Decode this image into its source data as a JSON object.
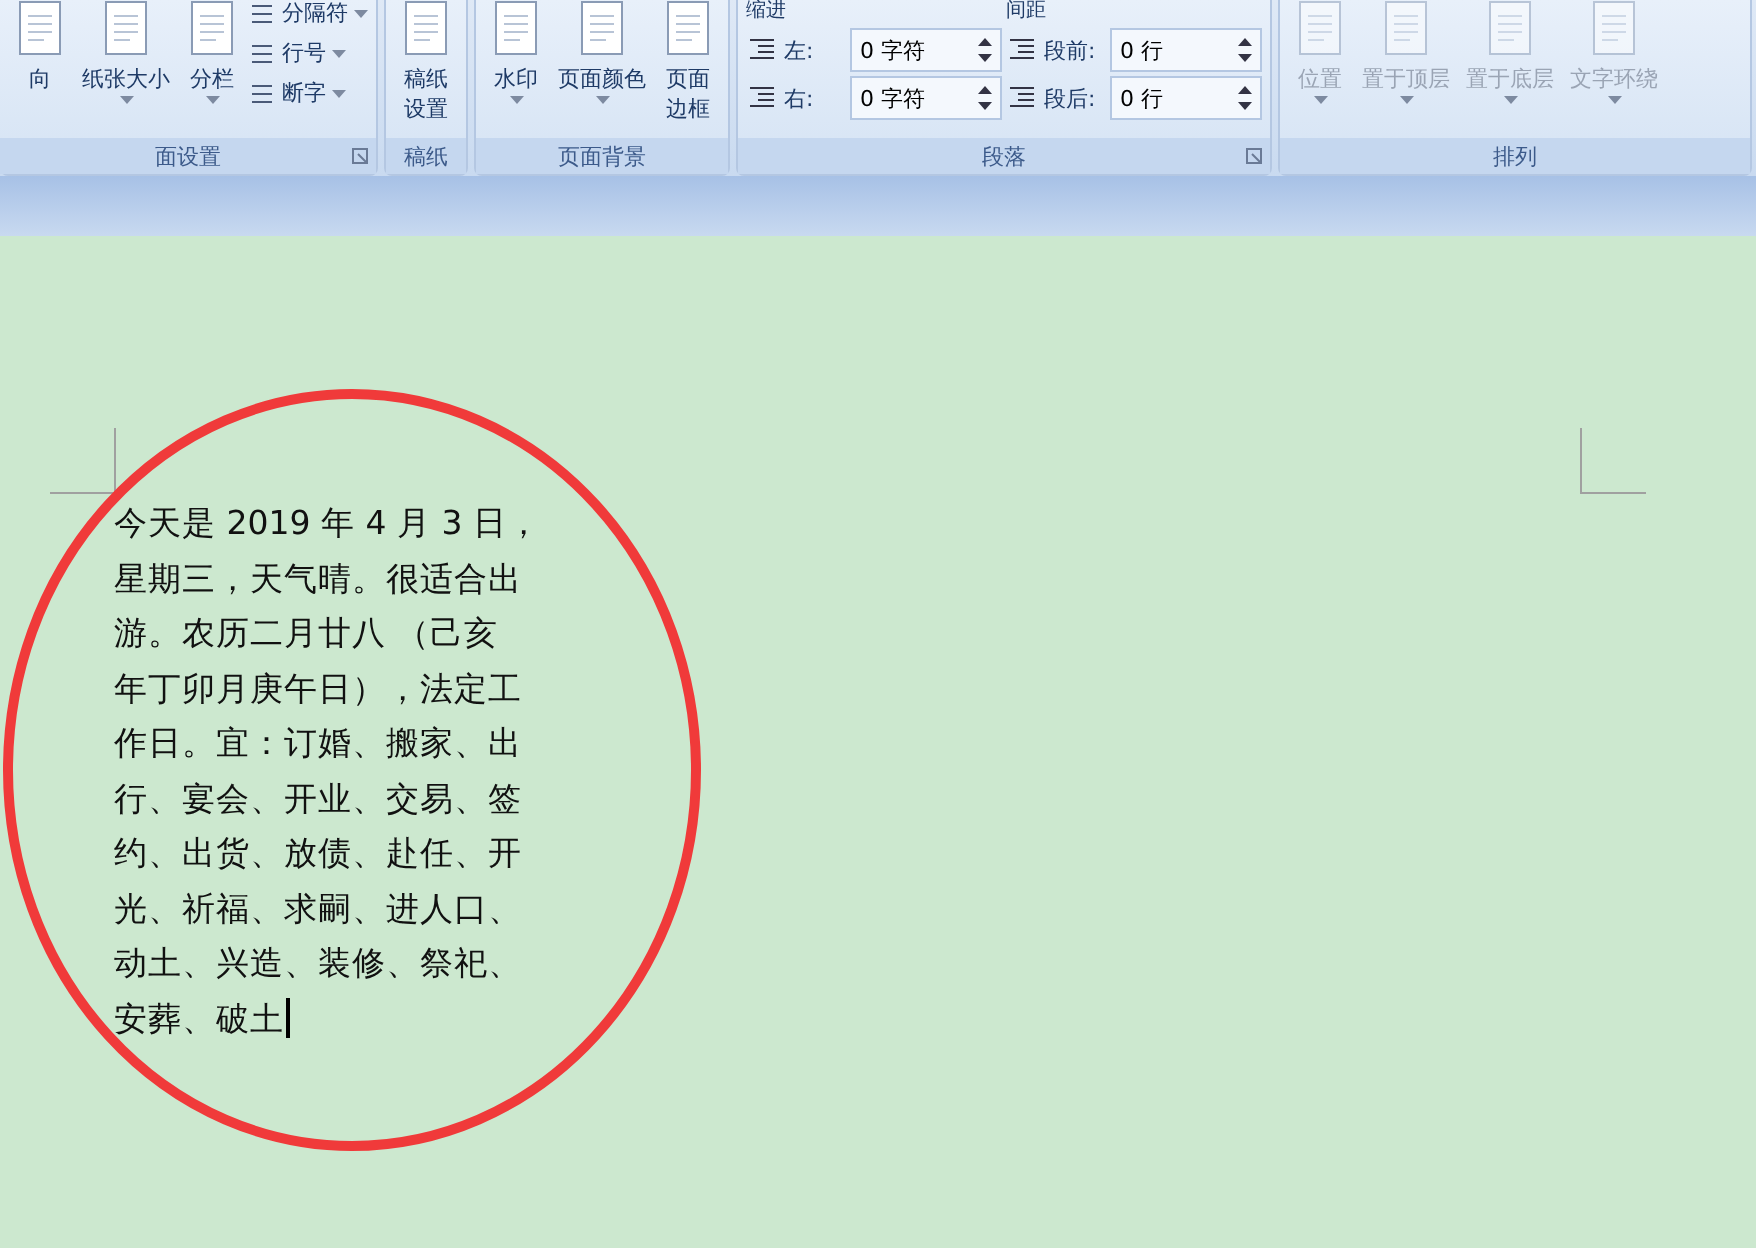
{
  "ribbon": {
    "groups": [
      {
        "title": "面设置",
        "launcher": true,
        "items": [
          {
            "kind": "large",
            "lines": [
              "向"
            ],
            "dropdown": false,
            "disabled": false
          },
          {
            "kind": "large",
            "lines": [
              "纸张大小"
            ],
            "dropdown": true,
            "disabled": false
          },
          {
            "kind": "large",
            "lines": [
              "分栏"
            ],
            "dropdown": true,
            "disabled": false
          },
          {
            "kind": "stack",
            "buttons": [
              {
                "label": "分隔符",
                "dropdown": true
              },
              {
                "label": "行号",
                "dropdown": true
              },
              {
                "label": "断字",
                "dropdown": true
              }
            ]
          }
        ]
      },
      {
        "title": "稿纸",
        "launcher": false,
        "items": [
          {
            "kind": "large",
            "lines": [
              "稿纸",
              "设置"
            ],
            "dropdown": false,
            "disabled": false
          }
        ]
      },
      {
        "title": "页面背景",
        "launcher": false,
        "items": [
          {
            "kind": "large",
            "lines": [
              "水印"
            ],
            "dropdown": true,
            "disabled": false
          },
          {
            "kind": "large",
            "lines": [
              "页面颜色"
            ],
            "dropdown": true,
            "disabled": false
          },
          {
            "kind": "large",
            "lines": [
              "页面",
              "边框"
            ],
            "dropdown": false,
            "disabled": false
          }
        ]
      },
      {
        "title": "段落",
        "launcher": true,
        "items": [
          {
            "kind": "spinners",
            "header": "缩进",
            "rows": [
              {
                "label": "左:",
                "value": "0 字符"
              },
              {
                "label": "右:",
                "value": "0 字符"
              }
            ]
          },
          {
            "kind": "spinners",
            "header": "间距",
            "rows": [
              {
                "label": "段前:",
                "value": "0 行"
              },
              {
                "label": "段后:",
                "value": "0 行"
              }
            ]
          }
        ]
      },
      {
        "title": "排列",
        "launcher": false,
        "items": [
          {
            "kind": "large",
            "lines": [
              "位置"
            ],
            "dropdown": true,
            "disabled": true
          },
          {
            "kind": "large",
            "lines": [
              "置于顶层"
            ],
            "dropdown": true,
            "disabled": true
          },
          {
            "kind": "large",
            "lines": [
              "置于底层"
            ],
            "dropdown": true,
            "disabled": true
          },
          {
            "kind": "large",
            "lines": [
              "文字环绕"
            ],
            "dropdown": true,
            "disabled": true
          }
        ]
      }
    ]
  },
  "document": {
    "lines": [
      "今天是 2019 年 4 月 3 日，",
      "星期三，天气晴。很适合出",
      "游。农历二月廿八 （己亥",
      "年丁卯月庚午日），法定工",
      "作日。宜：订婚、搬家、出",
      "行、宴会、开业、交易、签",
      "约、出货、放债、赴任、开",
      "光、祈福、求嗣、进人口、",
      "动土、兴造、装修、祭祀、",
      "安葬、破土"
    ],
    "circled": true
  }
}
